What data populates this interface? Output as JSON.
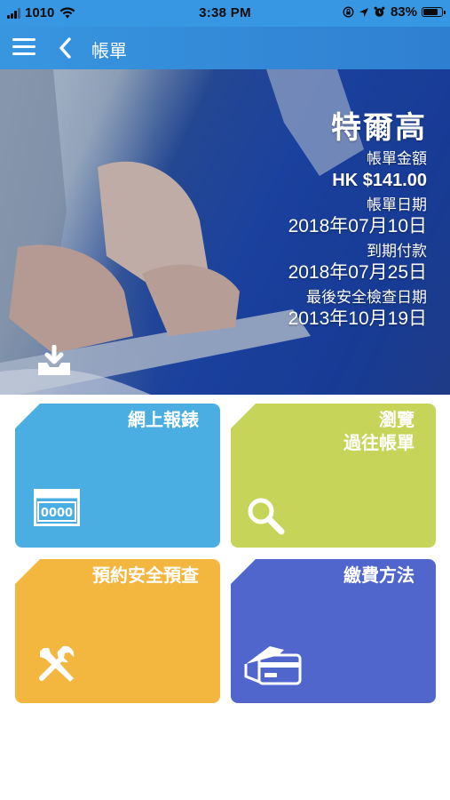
{
  "status_bar": {
    "carrier": "1010",
    "time": "3:38 PM",
    "battery_percent": "83%",
    "battery_level": 0.83
  },
  "nav": {
    "title": "帳單"
  },
  "bill": {
    "customer_name": "特爾高",
    "amount_label": "帳單金額",
    "amount": "HK $141.00",
    "bill_date_label": "帳單日期",
    "bill_date": "2018年07月10日",
    "due_label": "到期付款",
    "due_date": "2018年07月25日",
    "safety_check_label": "最後安全檢查日期",
    "safety_check_date": "2013年10月19日"
  },
  "tiles": [
    {
      "title": "網上報錶",
      "icon": "meter-icon",
      "color": "#4aaee3",
      "icon_text": "0000"
    },
    {
      "title_line1": "瀏覽",
      "title_line2": "過往帳單",
      "icon": "search-icon",
      "color": "#c6d55a"
    },
    {
      "title": "預約安全預查",
      "icon": "tools-icon",
      "color": "#f3b63e"
    },
    {
      "title": "繳費方法",
      "icon": "credit-card-icon",
      "color": "#5066cc"
    }
  ],
  "colors": {
    "status_bar": "#3797e2",
    "nav_bar": "#3896e0"
  }
}
